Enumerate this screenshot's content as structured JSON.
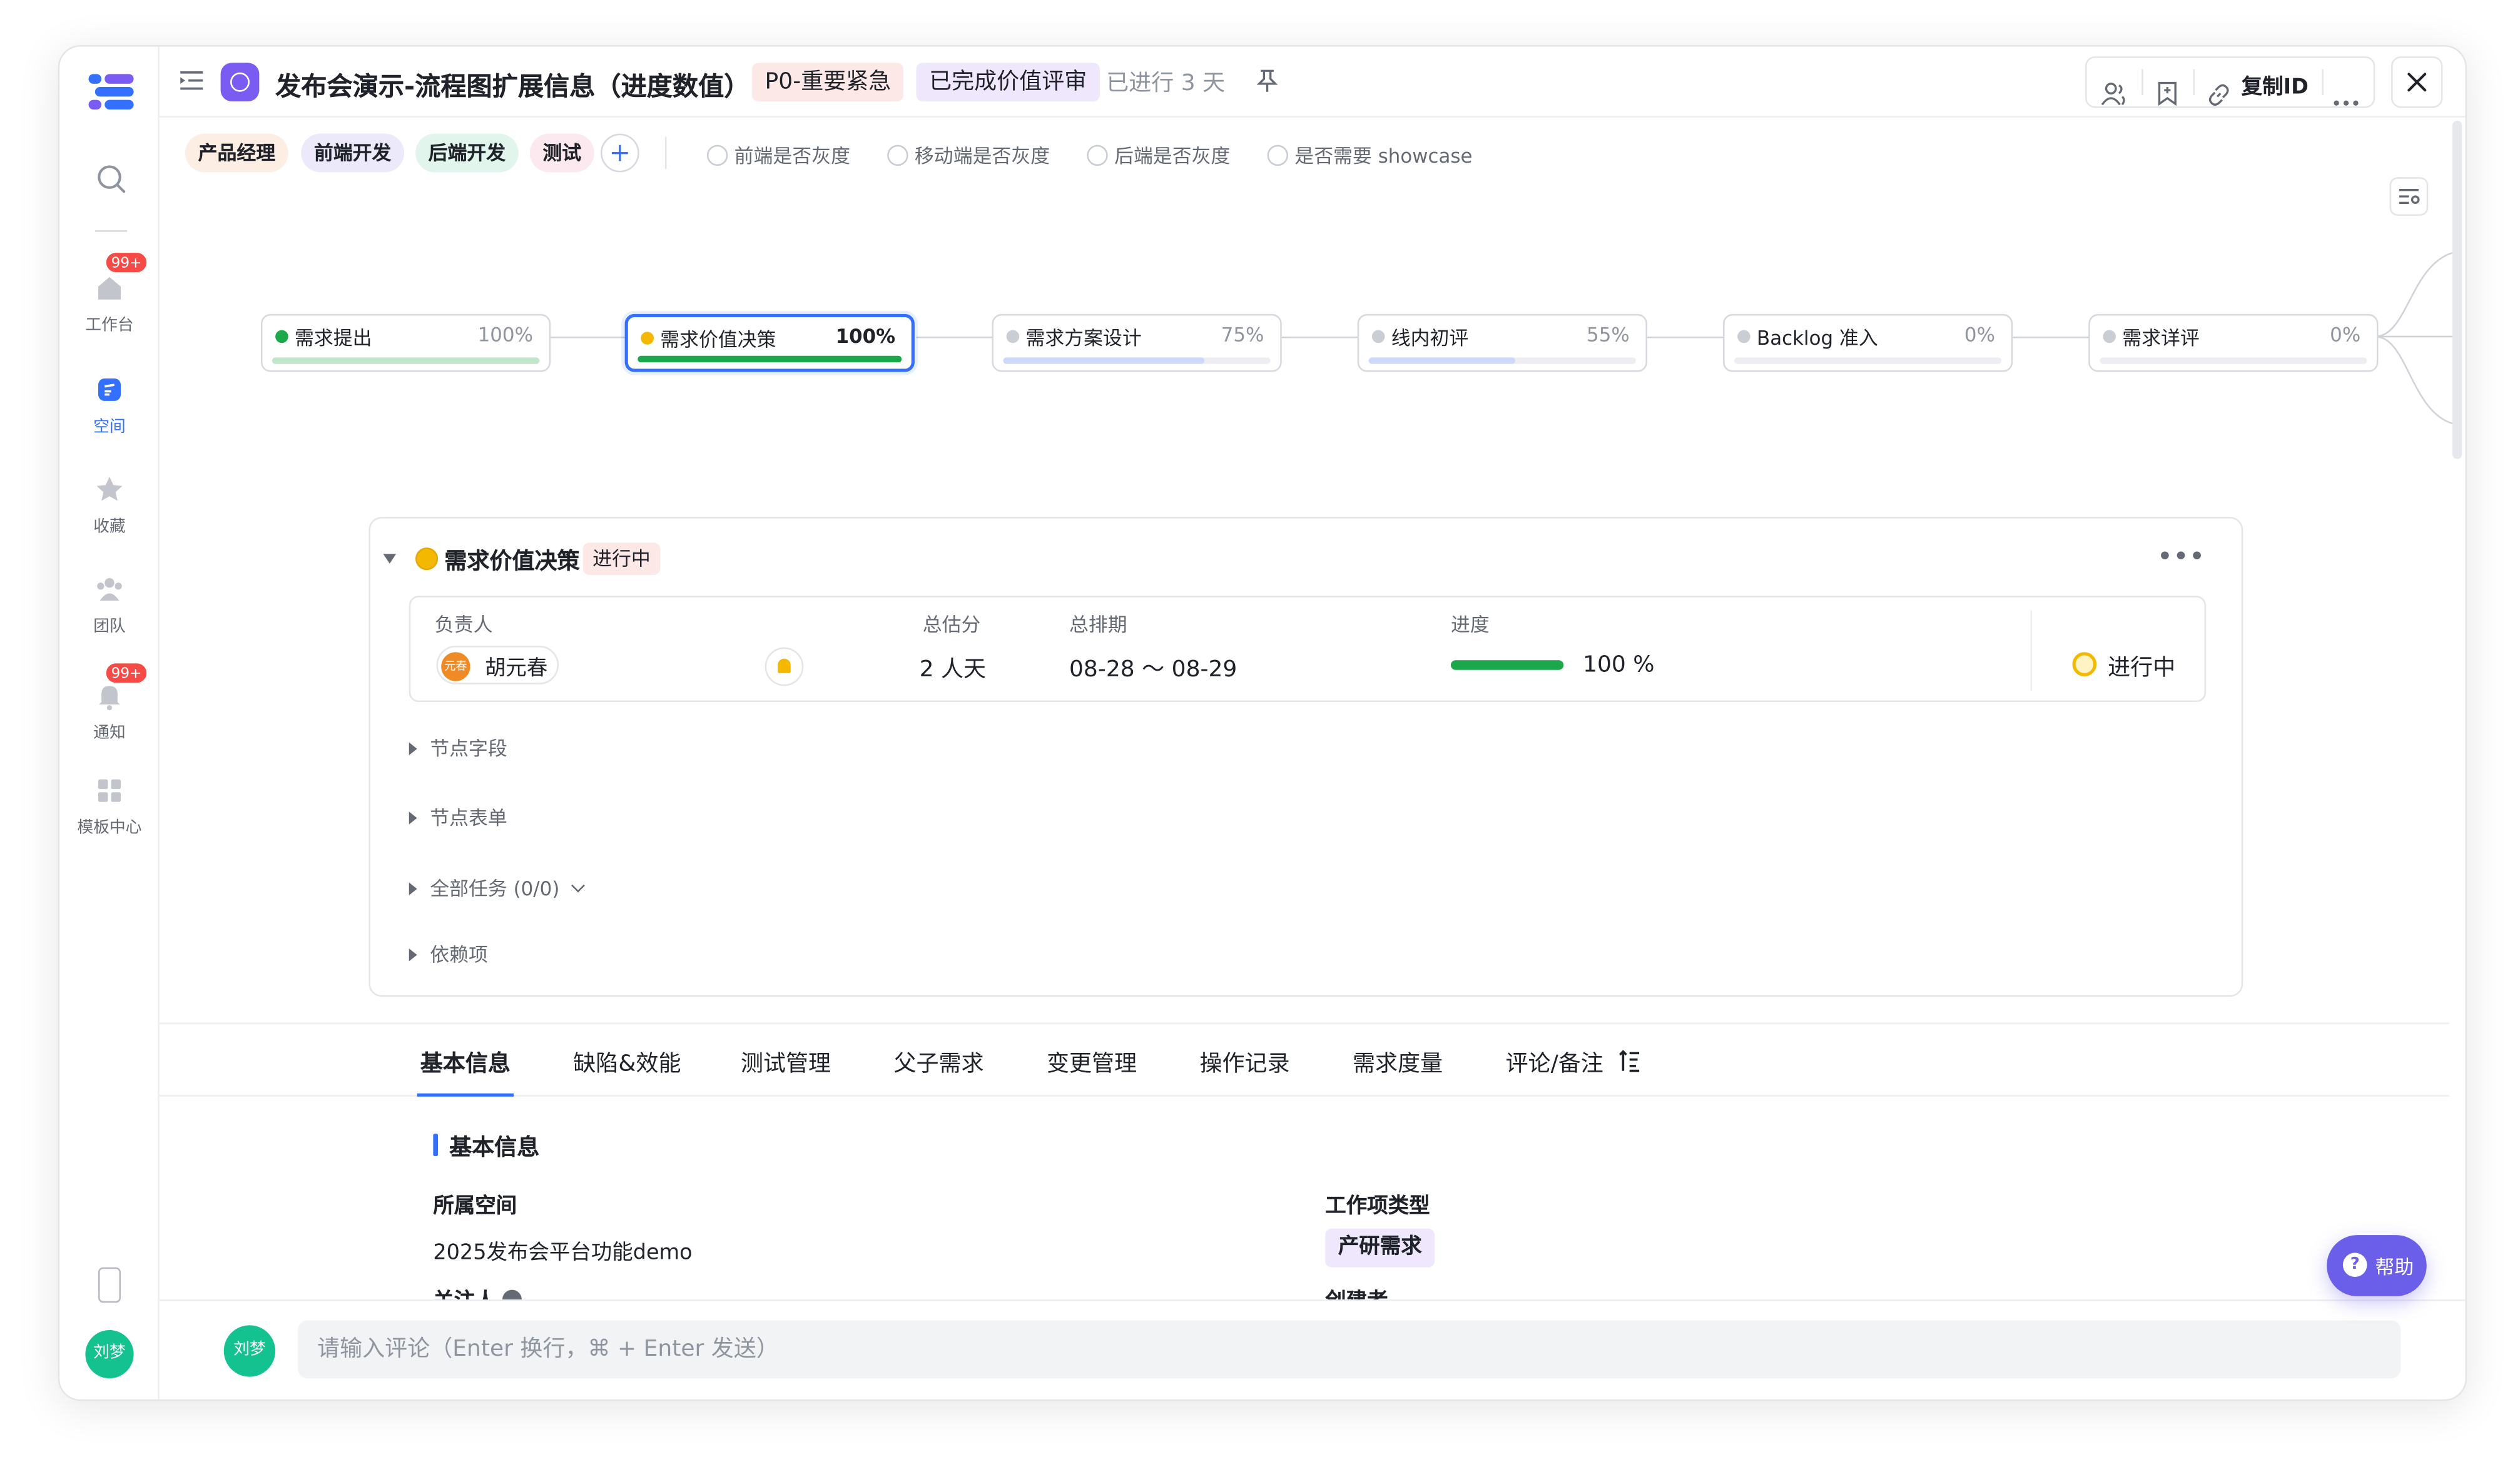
{
  "sidebar": {
    "items": [
      {
        "label": "工作台",
        "badge": "99+"
      },
      {
        "label": "空间"
      },
      {
        "label": "收藏"
      },
      {
        "label": "团队"
      },
      {
        "label": "通知",
        "badge": "99+"
      },
      {
        "label": "模板中心"
      }
    ],
    "user_avatar": "刘梦"
  },
  "header": {
    "title": "发布会演示-流程图扩展信息（进度数值）",
    "priority_tag": "P0-重要紧急",
    "status_tag": "已完成价值评审",
    "elapsed": "已进行 3 天",
    "copy_id_label": "复制ID"
  },
  "roles": [
    "产品经理",
    "前端开发",
    "后端开发",
    "测试"
  ],
  "checks": [
    "前端是否灰度",
    "移动端是否灰度",
    "后端是否灰度",
    "是否需要 showcase"
  ],
  "flow_nodes": [
    {
      "name": "需求提出",
      "percent_label": "100%",
      "progress": 1.0,
      "status_color": "#1ba84a",
      "bar_color": "#bfe6c8"
    },
    {
      "name": "需求价值决策",
      "percent_label": "100%",
      "progress": 1.0,
      "status_color": "#f5b800",
      "bar_color": "#1ba84a"
    },
    {
      "name": "需求方案设计",
      "percent_label": "75%",
      "progress": 0.75,
      "status_color": "#c9cdd4",
      "bar_color": "#cdd9fb"
    },
    {
      "name": "线内初评",
      "percent_label": "55%",
      "progress": 0.55,
      "status_color": "#c9cdd4",
      "bar_color": "#cdd9fb"
    },
    {
      "name": "Backlog 准入",
      "percent_label": "0%",
      "progress": 0,
      "status_color": "#c9cdd4",
      "bar_color": "#cdd9fb"
    },
    {
      "name": "需求详评",
      "percent_label": "0%",
      "progress": 0,
      "status_color": "#c9cdd4",
      "bar_color": "#cdd9fb"
    }
  ],
  "node_detail": {
    "title": "需求价值决策",
    "status": "进行中",
    "labels": {
      "owner": "负责人",
      "estimate": "总估分",
      "schedule": "总排期",
      "progress": "进度"
    },
    "owner_name": "胡元春",
    "owner_avatar": "元春",
    "estimate": "2 人天",
    "schedule": "08-28 ～ 08-29",
    "progress_label": "100 %",
    "progress": 1.0,
    "state": "进行中",
    "sections": [
      "节点字段",
      "节点表单",
      "全部任务 (0/0)",
      "依赖项"
    ]
  },
  "tabs": [
    "基本信息",
    "缺陷&效能",
    "测试管理",
    "父子需求",
    "变更管理",
    "操作记录",
    "需求度量",
    "评论/备注"
  ],
  "basic_info": {
    "title": "基本信息",
    "space_label": "所属空间",
    "space_value": "2025发布会平台功能demo",
    "type_label": "工作项类型",
    "type_value": "产研需求",
    "follower_label": "关注人",
    "creator_label": "创建者"
  },
  "comment": {
    "avatar": "刘梦",
    "placeholder": "请输入评论（Enter 换行，⌘ + Enter 发送）"
  },
  "help_label": "帮助",
  "colors": {
    "accent": "#3370ff",
    "brand_purple": "#7b5cf2",
    "success": "#1ba84a",
    "warning": "#f5b800"
  }
}
